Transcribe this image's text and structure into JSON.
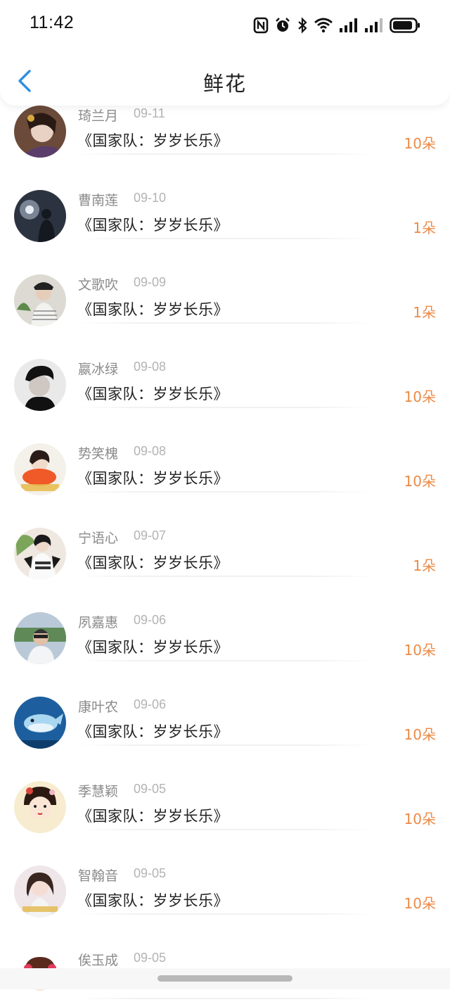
{
  "status_bar": {
    "time": "11:42"
  },
  "nav": {
    "title": "鲜花"
  },
  "items": [
    {
      "name": "琦兰月",
      "date": "09-11",
      "book": "《国家队：岁岁长乐》",
      "amount": "10朵"
    },
    {
      "name": "曹南莲",
      "date": "09-10",
      "book": "《国家队：岁岁长乐》",
      "amount": "1朵"
    },
    {
      "name": "文歌吹",
      "date": "09-09",
      "book": "《国家队：岁岁长乐》",
      "amount": "1朵"
    },
    {
      "name": "嬴冰绿",
      "date": "09-08",
      "book": "《国家队：岁岁长乐》",
      "amount": "10朵"
    },
    {
      "name": "势笑槐",
      "date": "09-08",
      "book": "《国家队：岁岁长乐》",
      "amount": "10朵"
    },
    {
      "name": "宁语心",
      "date": "09-07",
      "book": "《国家队：岁岁长乐》",
      "amount": "1朵"
    },
    {
      "name": "夙嘉惠",
      "date": "09-06",
      "book": "《国家队：岁岁长乐》",
      "amount": "10朵"
    },
    {
      "name": "康叶农",
      "date": "09-06",
      "book": "《国家队：岁岁长乐》",
      "amount": "10朵"
    },
    {
      "name": "季慧颖",
      "date": "09-05",
      "book": "《国家队：岁岁长乐》",
      "amount": "10朵"
    },
    {
      "name": "智翰音",
      "date": "09-05",
      "book": "《国家队：岁岁长乐》",
      "amount": "10朵"
    },
    {
      "name": "俟玉成",
      "date": "09-05",
      "book": "",
      "amount": ""
    }
  ],
  "colors": {
    "accent_blue": "#2f8fe0",
    "amount_orange": "#ec8a46",
    "name_gray": "#8a8a8a",
    "date_gray": "#b3b3b3"
  },
  "icons": [
    "nfc-icon",
    "alarm-icon",
    "bluetooth-icon",
    "wifi-icon",
    "cellular-signal-icon",
    "battery-icon",
    "back-arrow-icon"
  ]
}
